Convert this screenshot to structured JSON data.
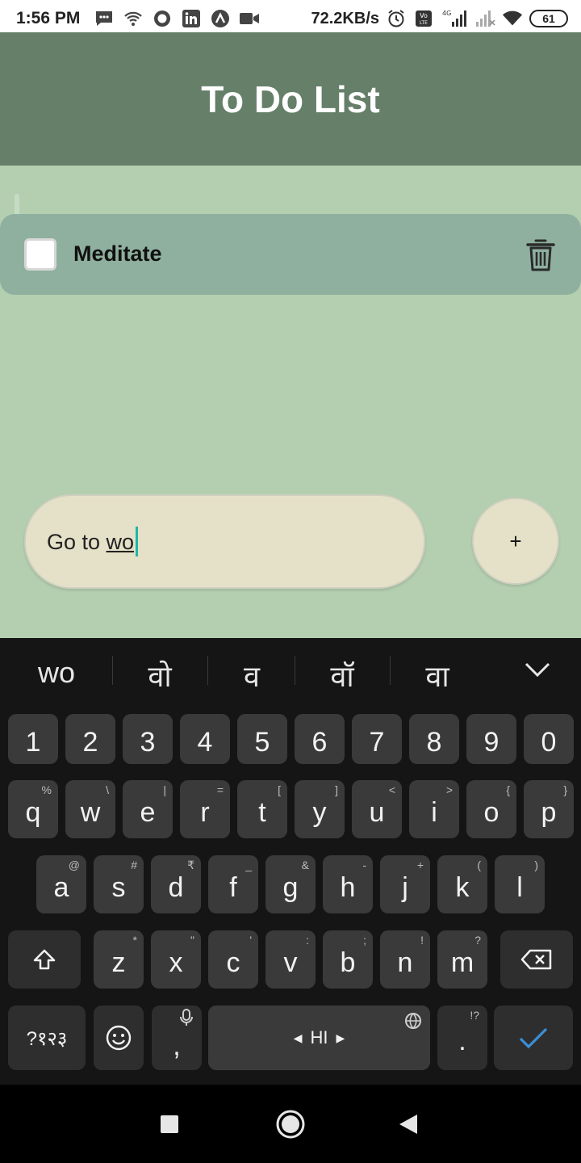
{
  "status_bar": {
    "time": "1:56 PM",
    "speed": "72.2KB/s",
    "battery": "61",
    "network_label": "4G",
    "icons_left": [
      "message-icon",
      "hotspot-icon",
      "circle-app-icon",
      "linkedin-icon",
      "arc-icon",
      "video-icon"
    ],
    "icons_right": [
      "alarm-icon",
      "volte-icon",
      "signal-icon",
      "signal-weak-icon",
      "wifi-icon"
    ]
  },
  "app": {
    "title": "To Do List",
    "header_color": "#657f69",
    "background_color": "#b4cfb0"
  },
  "todos": [
    {
      "label": "Meditate",
      "checked": false
    }
  ],
  "input": {
    "value_prefix": "Go to ",
    "value_composing": "wo",
    "add_label": "+"
  },
  "keyboard": {
    "suggestions": [
      "wo",
      "वो",
      "व",
      "वॉ",
      "वा"
    ],
    "row_numbers": [
      "1",
      "2",
      "3",
      "4",
      "5",
      "6",
      "7",
      "8",
      "9",
      "0"
    ],
    "row1": [
      {
        "k": "q",
        "h": "%"
      },
      {
        "k": "w",
        "h": "\\"
      },
      {
        "k": "e",
        "h": "|"
      },
      {
        "k": "r",
        "h": "="
      },
      {
        "k": "t",
        "h": "["
      },
      {
        "k": "y",
        "h": "]"
      },
      {
        "k": "u",
        "h": "<"
      },
      {
        "k": "i",
        "h": ">"
      },
      {
        "k": "o",
        "h": "{"
      },
      {
        "k": "p",
        "h": "}"
      }
    ],
    "row2": [
      {
        "k": "a",
        "h": "@"
      },
      {
        "k": "s",
        "h": "#"
      },
      {
        "k": "d",
        "h": "₹"
      },
      {
        "k": "f",
        "h": "_"
      },
      {
        "k": "g",
        "h": "&"
      },
      {
        "k": "h",
        "h": "-"
      },
      {
        "k": "j",
        "h": "+"
      },
      {
        "k": "k",
        "h": "("
      },
      {
        "k": "l",
        "h": ")"
      }
    ],
    "row3": [
      {
        "k": "z",
        "h": "*"
      },
      {
        "k": "x",
        "h": "\""
      },
      {
        "k": "c",
        "h": "'"
      },
      {
        "k": "v",
        "h": ":"
      },
      {
        "k": "b",
        "h": ";"
      },
      {
        "k": "n",
        "h": "!"
      },
      {
        "k": "m",
        "h": "?"
      }
    ],
    "symbols_label": "?१२३",
    "comma_label": ",",
    "space_label": "HI",
    "period_label": ".",
    "period_hint": "!?"
  }
}
